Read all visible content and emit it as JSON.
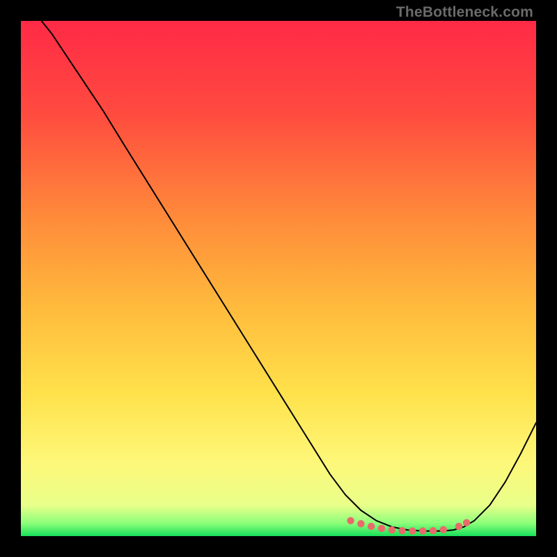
{
  "watermark": "TheBottleneck.com",
  "chart_data": {
    "type": "line",
    "title": "",
    "xlabel": "",
    "ylabel": "",
    "xlim": [
      0,
      100
    ],
    "ylim": [
      0,
      100
    ],
    "grid": false,
    "legend": false,
    "gradient_stops": [
      {
        "offset": 0.0,
        "color": "#ff2a46"
      },
      {
        "offset": 0.18,
        "color": "#ff4b3f"
      },
      {
        "offset": 0.38,
        "color": "#ff8a3a"
      },
      {
        "offset": 0.55,
        "color": "#ffb93c"
      },
      {
        "offset": 0.72,
        "color": "#ffe14a"
      },
      {
        "offset": 0.86,
        "color": "#fdf87a"
      },
      {
        "offset": 0.94,
        "color": "#e9ff8a"
      },
      {
        "offset": 0.975,
        "color": "#8cff7a"
      },
      {
        "offset": 1.0,
        "color": "#18e05a"
      }
    ],
    "series": [
      {
        "name": "bottleneck-curve",
        "stroke": "#000000",
        "stroke_width": 2.0,
        "x": [
          4,
          6,
          8,
          10,
          12,
          14,
          16,
          20,
          25,
          30,
          35,
          40,
          45,
          50,
          55,
          60,
          63,
          66,
          69,
          72,
          75,
          78,
          80,
          82,
          84,
          86,
          88,
          91,
          94,
          97,
          100
        ],
        "y": [
          100,
          97.5,
          94.5,
          91.5,
          88.5,
          85.5,
          82.5,
          76,
          68,
          60,
          52,
          44,
          36,
          28,
          20,
          12,
          8,
          5,
          3,
          1.8,
          1.2,
          1.0,
          1.0,
          1.0,
          1.2,
          1.8,
          3,
          6,
          10.5,
          16,
          22
        ]
      }
    ],
    "markers": {
      "name": "highlight-dots",
      "color": "#e86a6a",
      "radius": 5.2,
      "x": [
        64,
        66,
        68,
        70,
        72,
        74,
        76,
        78,
        80,
        82,
        85,
        86.5
      ],
      "y": [
        3.0,
        2.4,
        1.9,
        1.5,
        1.2,
        1.05,
        1.0,
        1.0,
        1.05,
        1.25,
        1.9,
        2.6
      ]
    }
  }
}
